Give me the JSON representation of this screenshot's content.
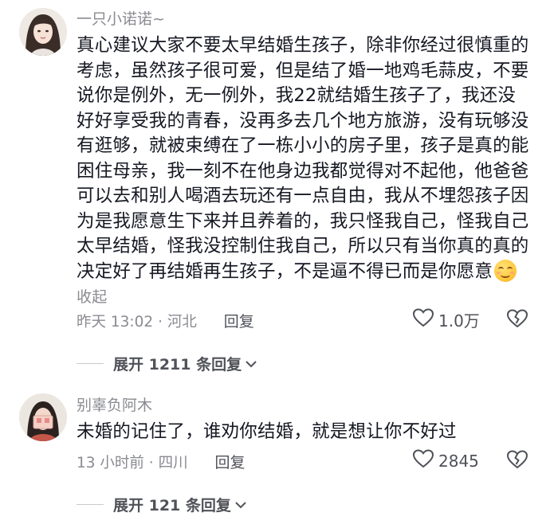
{
  "comments": [
    {
      "username": "一只小诺诺~",
      "text": "真心建议大家不要太早结婚生孩子，除非你经过很慎重的考虑，虽然孩子很可爱，但是结了婚一地鸡毛蒜皮，不要说你是例外，无一例外，我22就结婚生孩子了，我还没好好享受我的青春，没再多去几个地方旅游，没有玩够没有逛够，就被束缚在了一栋小小的房子里，孩子是真的能困住母亲，我一刻不在他身边我都觉得对不起他，他爸爸可以去和别人喝酒去玩还有一点自由，我从不埋怨孩子因为是我愿意生下来并且养着的，我只怪我自己，怪我自己太早结婚，怪我没控制住我自己，所以只有当你真的真的决定好了再结婚再生孩子，不是逼不得已而是你愿意",
      "emoji": "smiling-blush-emoji",
      "collapse_label": "收起",
      "time_location": "昨天 13:02 · 河北",
      "reply_label": "回复",
      "likes": "1.0万",
      "expand_label": "展开 1211 条回复"
    },
    {
      "username": "别辜负阿木",
      "text": "未婚的记住了，谁劝你结婚，就是想让你不好过",
      "time_location": "13 小时前 · 四川",
      "reply_label": "回复",
      "likes": "2845",
      "expand_label": "展开 121 条回复"
    }
  ],
  "icons": {
    "like": "heart-outline-icon",
    "dislike": "broken-heart-icon",
    "expand": "chevron-down-icon"
  },
  "colors": {
    "text": "#161823",
    "secondary": "#8a8b91",
    "action": "#505259"
  }
}
